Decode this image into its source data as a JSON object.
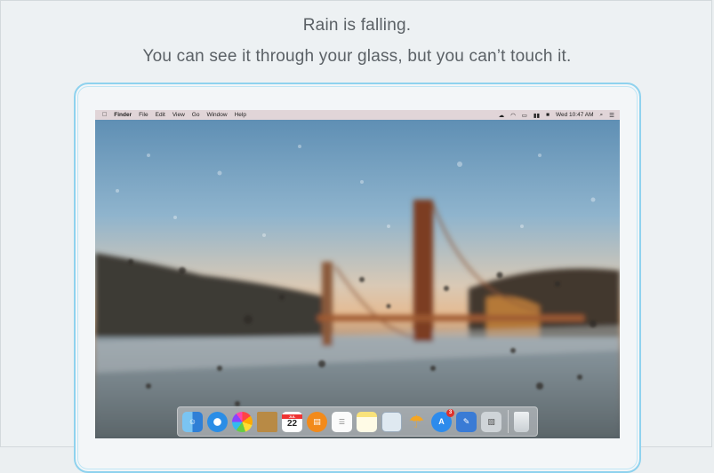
{
  "headline": "Rain is falling.",
  "subheadline": "You can see it through your glass, but you can’t touch it.",
  "menubar": {
    "apple_icon": "apple-icon",
    "items": [
      "Finder",
      "File",
      "Edit",
      "View",
      "Go",
      "Window",
      "Help"
    ],
    "status_icons": [
      "cloud-icon",
      "wifi-icon",
      "airplay-icon",
      "battery-icon",
      "keyboard-icon"
    ],
    "clock": "Wed 10:47 AM"
  },
  "dock": {
    "icons": [
      "finder-icon",
      "safari-icon",
      "photos-icon",
      "contacts-icon",
      "calendar-icon",
      "ibooks-icon",
      "reminders-icon",
      "notes-icon",
      "preview-icon",
      "sun-umbrella-icon",
      "app-store-icon",
      "xcode-icon",
      "image-capture-icon",
      "trash-icon"
    ],
    "calendar_date": "22",
    "calendar_month": "JUL",
    "app_store_badge": "3"
  },
  "colors": {
    "accent": "#8fd2ee",
    "background": "#ebeff1",
    "text": "#5b6166"
  }
}
